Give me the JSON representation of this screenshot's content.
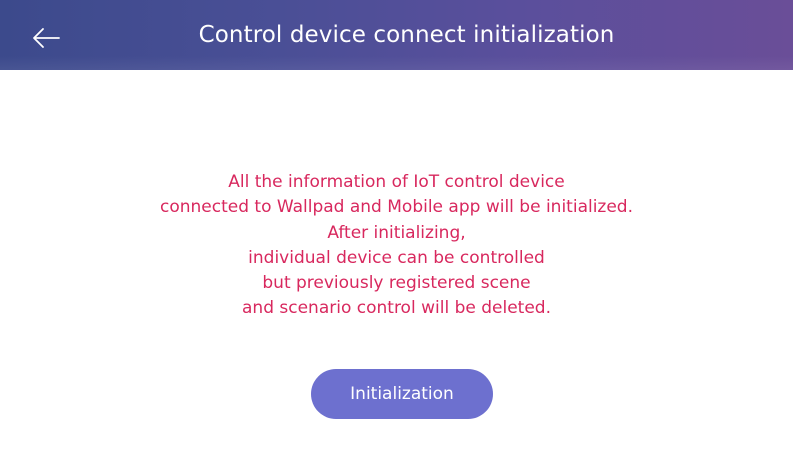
{
  "header": {
    "title": "Control device connect initialization",
    "back_icon": "arrow-left-icon"
  },
  "message": {
    "color": "#d8285e",
    "lines": [
      "All the information of IoT control device",
      "connected to Wallpad and Mobile app will be initialized.",
      "After initializing,",
      "individual device can be controlled",
      "but previously registered scene",
      "and scenario control will be deleted."
    ]
  },
  "actions": {
    "initialize_label": "Initialization",
    "button_color": "#6d70cf"
  }
}
